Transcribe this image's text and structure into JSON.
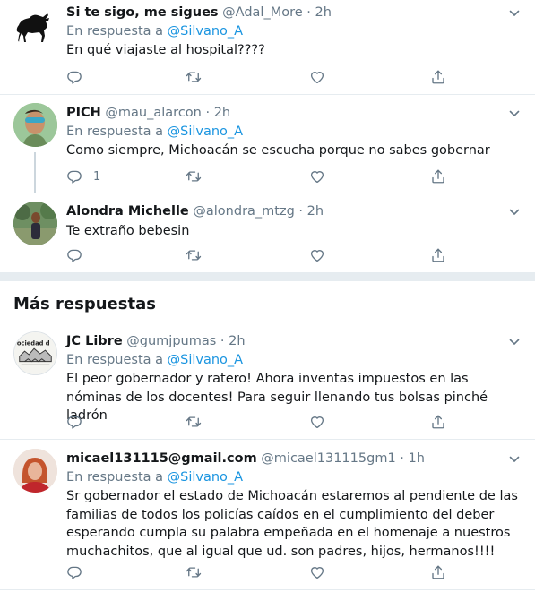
{
  "tweets": [
    {
      "name": "Si te sigo, me sigues",
      "handle": "@Adal_More",
      "time": "2h",
      "reply_prefix": "En respuesta a",
      "reply_to": "@Silvano_A",
      "text": "En qué viajaste al hospital????",
      "reply_count": ""
    },
    {
      "name": "PICH",
      "handle": "@mau_alarcon",
      "time": "2h",
      "reply_prefix": "En respuesta a",
      "reply_to": "@Silvano_A",
      "text": "Como siempre, Michoacán se escucha porque no sabes gobernar",
      "reply_count": "1"
    },
    {
      "name": "Alondra Michelle",
      "handle": "@alondra_mtzg",
      "time": "2h",
      "text": "Te extraño bebesin",
      "reply_count": ""
    },
    {
      "name": "JC Libre",
      "handle": "@gumjpumas",
      "time": "2h",
      "reply_prefix": "En respuesta a",
      "reply_to": "@Silvano_A",
      "text": "El peor gobernador y ratero! Ahora inventas impuestos en las nóminas de los docentes! Para seguir llenando tus bolsas pinché ladrón",
      "reply_count": ""
    },
    {
      "name": "micael131115@gmail.com",
      "handle": "@micael131115gm1",
      "time": "1h",
      "reply_prefix": "En respuesta a",
      "reply_to": "@Silvano_A",
      "text": "Sr gobernador el estado de Michoacán estaremos al pendiente de las familias de todos los policías caídos en el cumplimiento del deber esperando cumpla su palabra empeñada en el homenaje a nuestros muchachitos, que al igual que ud. son padres, hijos, hermanos!!!!",
      "reply_count": ""
    }
  ],
  "section": {
    "more_replies": "Más respuestas"
  },
  "separator": "·",
  "avatar_logo_text": "ociedad d",
  "colors": {
    "accent": "#1b95e0",
    "muted": "#657786",
    "border": "#e6ecf0"
  }
}
